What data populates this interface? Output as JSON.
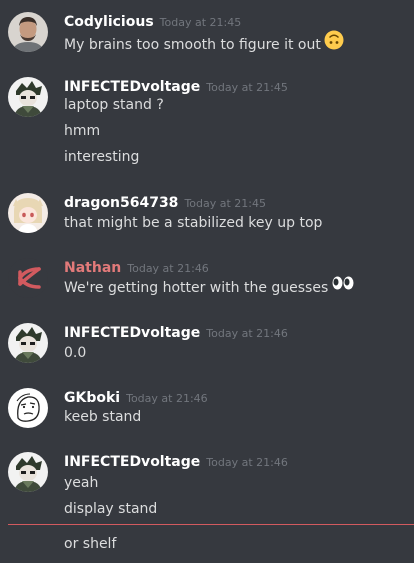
{
  "messages": [
    {
      "username": "Codylicious",
      "timestamp": "Today at 21:45",
      "lines": [
        "My brains too smooth to figure it out"
      ],
      "avatar_icon": "person-photo-avatar",
      "inline_emoji": "upside-down-face-emoji"
    },
    {
      "username": "INFECTEDvoltage",
      "timestamp": "Today at 21:45",
      "lines": [
        "laptop stand ?",
        "hmm",
        "interesting"
      ],
      "avatar_icon": "anime-character-avatar"
    },
    {
      "username": "dragon564738",
      "timestamp": "Today at 21:45",
      "lines": [
        "that might be a stabilized key up top"
      ],
      "avatar_icon": "anime-girl-avatar"
    },
    {
      "username": "Nathan",
      "timestamp": "Today at 21:46",
      "lines": [
        "We're getting hotter with the guesses"
      ],
      "avatar_icon": "fish-symbol-avatar",
      "inline_emoji": "eyes-emoji",
      "name_color": "#e27a7a"
    },
    {
      "username": "INFECTEDvoltage",
      "timestamp": "Today at 21:46",
      "lines": [
        "0.0"
      ],
      "avatar_icon": "anime-character-avatar"
    },
    {
      "username": "GKboki",
      "timestamp": "Today at 21:46",
      "lines": [
        "keeb stand"
      ],
      "avatar_icon": "meme-face-avatar"
    },
    {
      "username": "INFECTEDvoltage",
      "timestamp": "Today at 21:46",
      "lines": [
        "yeah",
        "display stand",
        "or shelf"
      ],
      "avatar_icon": "anime-character-avatar"
    }
  ],
  "colors": {
    "background": "#36393f",
    "text": "#dcddde",
    "username": "#ffffff",
    "timestamp": "#72767d",
    "new_message_divider": "#d25a5f"
  }
}
